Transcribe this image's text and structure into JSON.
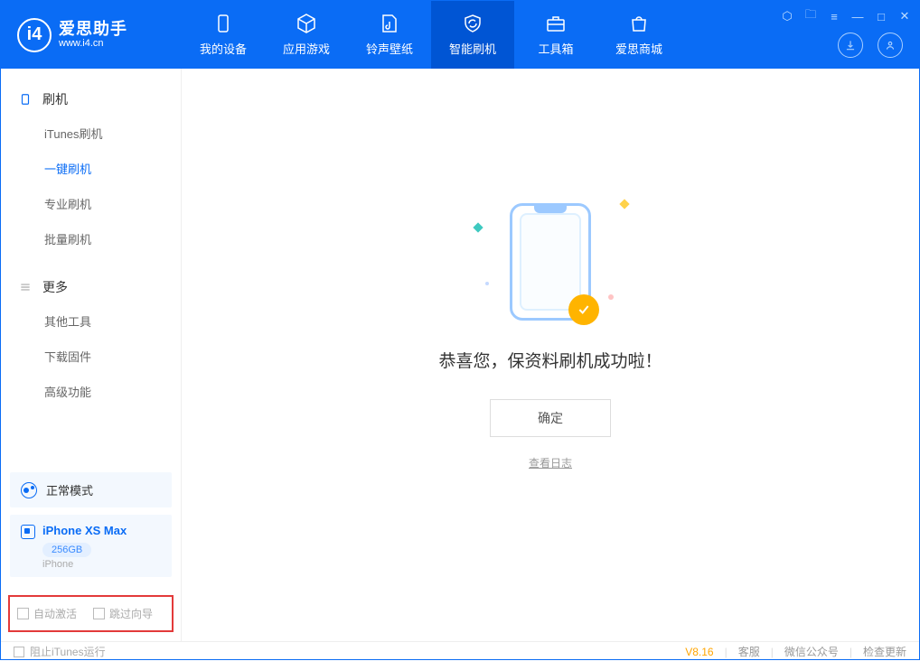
{
  "logo": {
    "letter": "i4",
    "cn": "爱思助手",
    "url": "www.i4.cn"
  },
  "nav": [
    {
      "label": "我的设备"
    },
    {
      "label": "应用游戏"
    },
    {
      "label": "铃声壁纸"
    },
    {
      "label": "智能刷机"
    },
    {
      "label": "工具箱"
    },
    {
      "label": "爱思商城"
    }
  ],
  "sidebar": {
    "flash_header": "刷机",
    "flash_items": [
      "iTunes刷机",
      "一键刷机",
      "专业刷机",
      "批量刷机"
    ],
    "more_header": "更多",
    "more_items": [
      "其他工具",
      "下载固件",
      "高级功能"
    ]
  },
  "mode": {
    "label": "正常模式"
  },
  "device": {
    "name": "iPhone XS Max",
    "capacity": "256GB",
    "type": "iPhone"
  },
  "options": {
    "auto_activate": "自动激活",
    "skip_guide": "跳过向导"
  },
  "main": {
    "success_text": "恭喜您，保资料刷机成功啦！",
    "ok_btn": "确定",
    "view_log": "查看日志"
  },
  "footer": {
    "block_itunes": "阻止iTunes运行",
    "version": "V8.16",
    "support": "客服",
    "wechat": "微信公众号",
    "update": "检查更新"
  }
}
